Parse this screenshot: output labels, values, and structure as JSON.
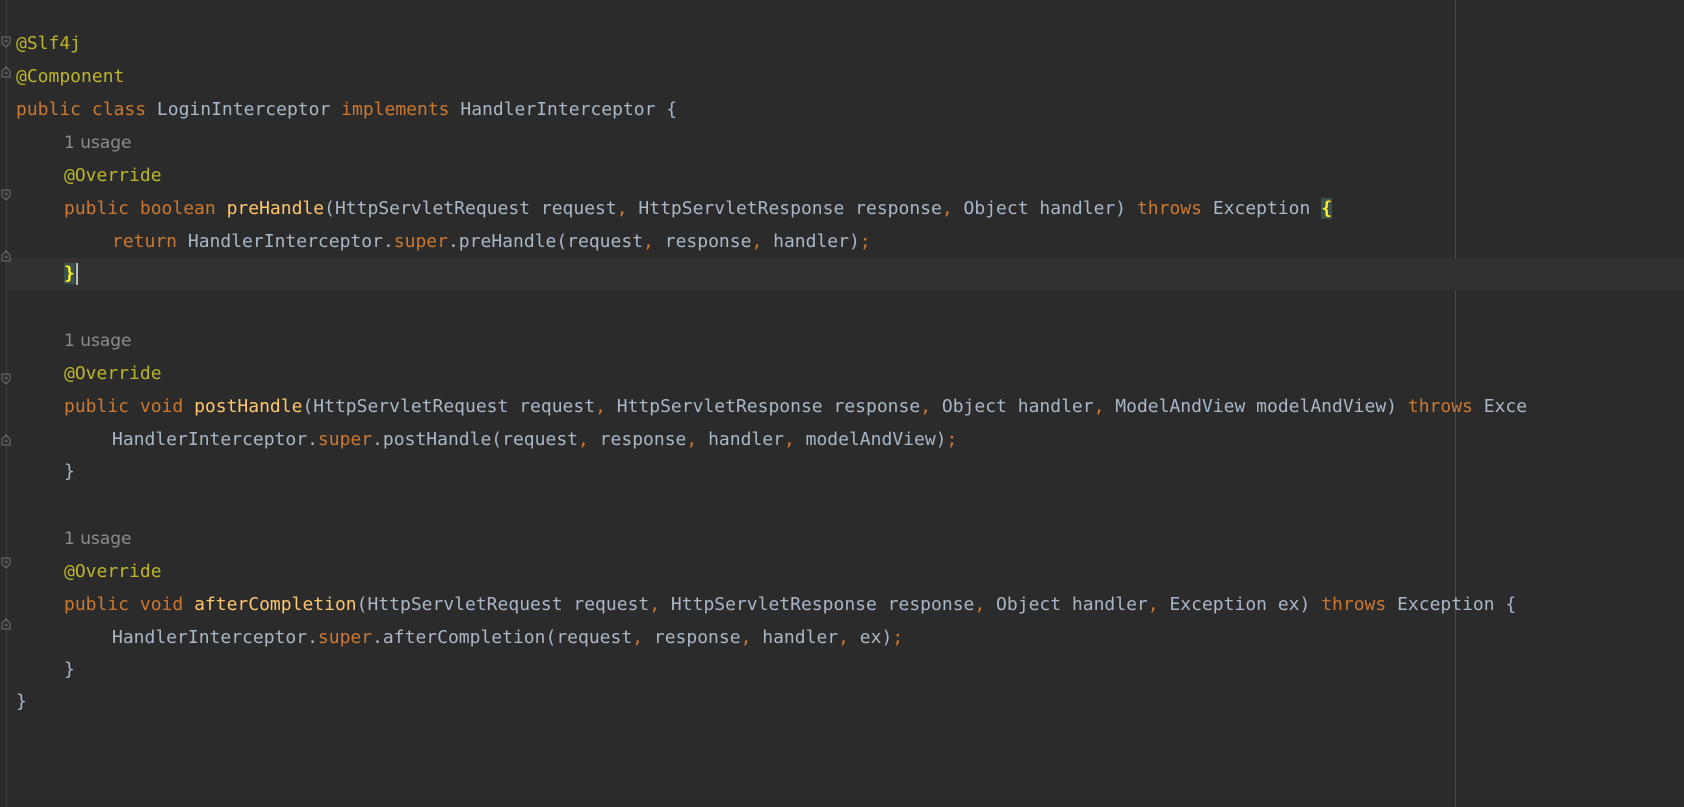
{
  "code": {
    "annotation_slf4j": "@Slf4j",
    "annotation_component": "@Component",
    "class_decl": {
      "kw_public": "public",
      "kw_class": "class",
      "class_name": "LoginInterceptor",
      "kw_implements": "implements",
      "iface": "HandlerInterceptor",
      "open": "{"
    },
    "usage_hint": "1 usage",
    "override": "@Override",
    "kw_public": "public",
    "kw_boolean": "boolean",
    "kw_void": "void",
    "kw_throws": "throws",
    "kw_return": "return",
    "kw_super": "super",
    "exception": "Exception",
    "comma": ",",
    "semicolon": ";",
    "close": "}",
    "method1": {
      "name": "preHandle",
      "params_a": "(HttpServletRequest request",
      "params_b": " HttpServletResponse response",
      "params_c": " Object handler) ",
      "body_a": "HandlerInterceptor.",
      "body_b": ".preHandle(request",
      "body_c": " response",
      "body_d": " handler)",
      "open_brace": "{",
      "close_brace": "}"
    },
    "method2": {
      "name": "postHandle",
      "params_a": "(HttpServletRequest request",
      "params_b": " HttpServletResponse response",
      "params_c": " Object handler",
      "params_d": " ModelAndView modelAndView) ",
      "tail": "Exce",
      "body_a": "HandlerInterceptor.",
      "body_b": ".postHandle(request",
      "body_c": " response",
      "body_d": " handler",
      "body_e": " modelAndView)"
    },
    "method3": {
      "name": "afterCompletion",
      "params_a": "(HttpServletRequest request",
      "params_b": " HttpServletResponse response",
      "params_c": " Object handler",
      "params_d": " Exception ex) ",
      "tail": "Exception {",
      "body_a": "HandlerInterceptor.",
      "body_b": ".afterCompletion(request",
      "body_c": " response",
      "body_d": " handler",
      "body_e": " ex)"
    }
  },
  "colors": {
    "background": "#2b2b2b",
    "keyword": "#cc7832",
    "annotation": "#bbb529",
    "method": "#ffc66d",
    "text": "#a9b7c6",
    "hint": "#8c8c8c"
  }
}
